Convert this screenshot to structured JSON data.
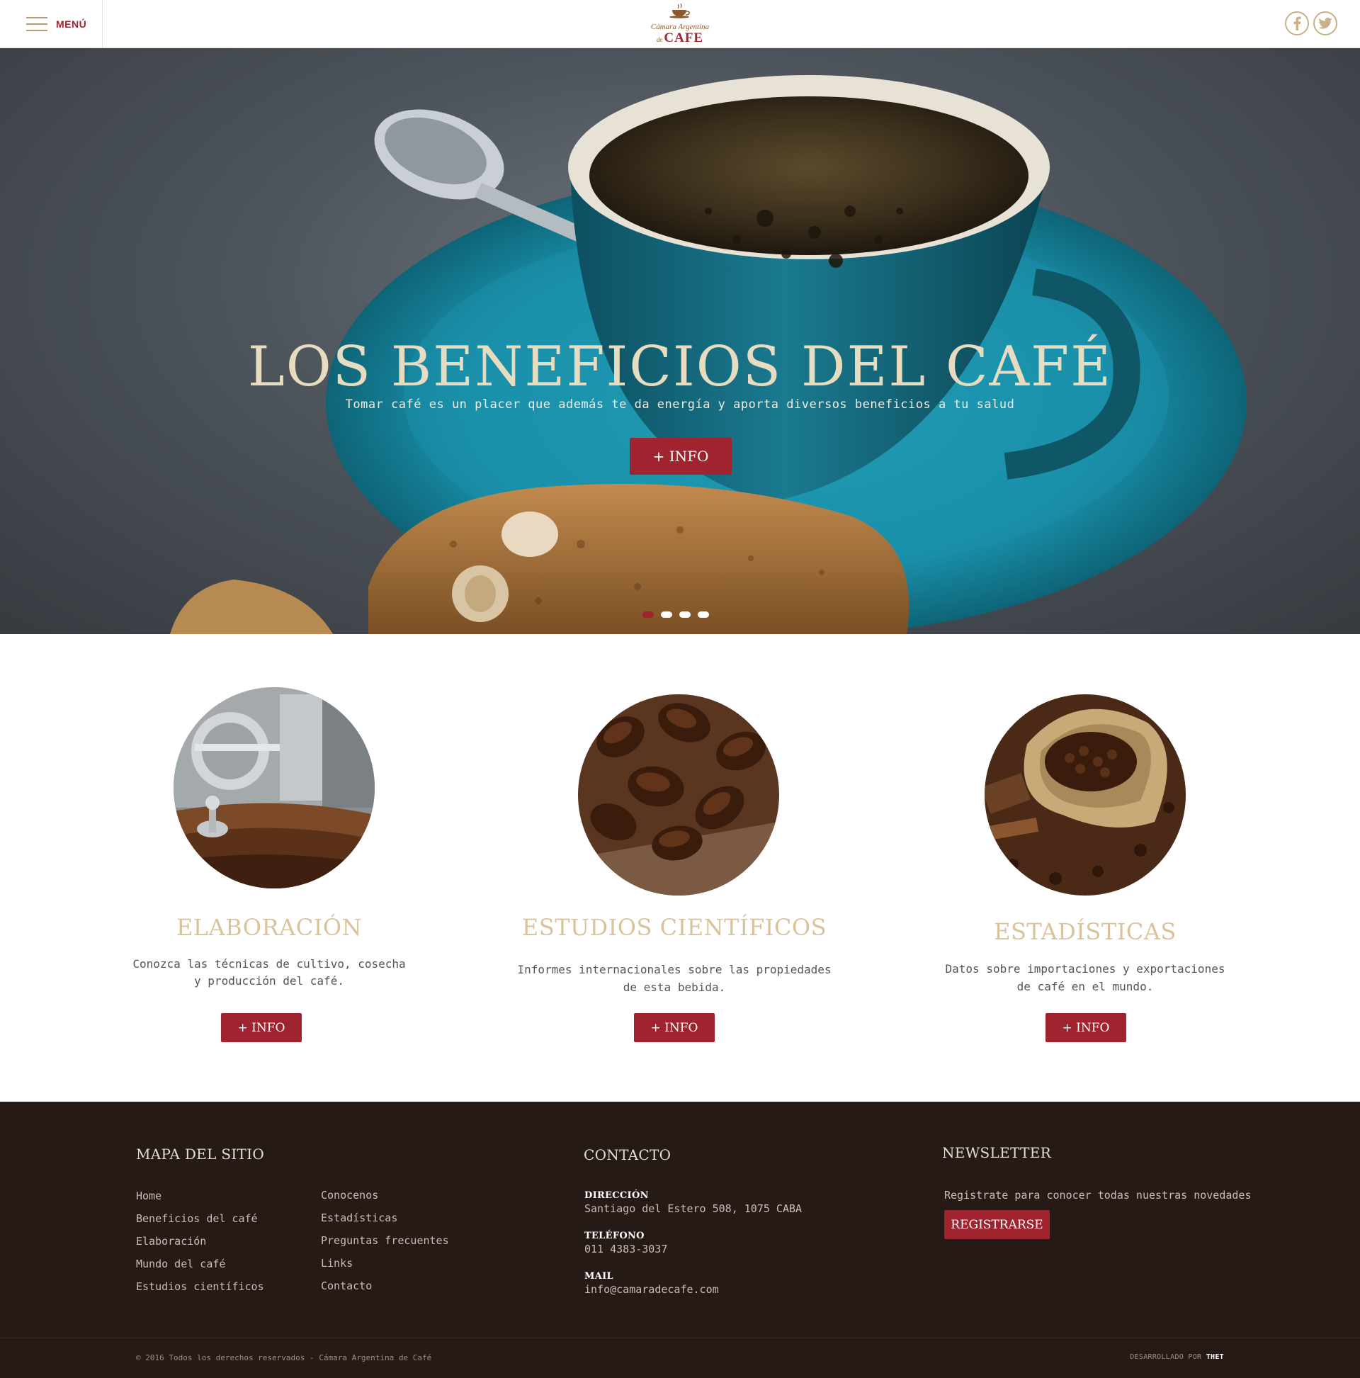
{
  "header": {
    "menu_label": "MENÚ",
    "logo_line1": "Cámara Argentina",
    "logo_de": "de",
    "logo_cafe": "CAFE"
  },
  "hero": {
    "title": "LOS BENEFICIOS DEL CAFÉ",
    "subtitle": "Tomar café es un placer que además te da energía y aporta diversos beneficios a tu salud",
    "button": "+ INFO",
    "slide_count": 4,
    "active_slide": 1
  },
  "features": [
    {
      "title": "ELABORACIÓN",
      "line1": "Conozca las técnicas de cultivo, cosecha",
      "line2": "y producción del café.",
      "button": "+ INFO"
    },
    {
      "title": "ESTUDIOS CIENTÍFICOS",
      "line1": "Informes internacionales sobre las propiedades",
      "line2": "de esta bebida.",
      "button": "+ INFO"
    },
    {
      "title": "ESTADÍSTICAS",
      "line1": "Datos sobre importaciones y exportaciones",
      "line2": "de café en el mundo.",
      "button": "+ INFO"
    }
  ],
  "footer": {
    "sitemap_title": "MAPA DEL SITIO",
    "sitemap_col1": [
      "Home",
      "Beneficios del café",
      "Elaboración",
      "Mundo del café",
      "Estudios científicos"
    ],
    "sitemap_col2": [
      "Conocenos",
      "Estadísticas",
      "Preguntas frecuentes",
      "Links",
      "Contacto"
    ],
    "contact_title": "CONTACTO",
    "address_label": "DIRECCIÓN",
    "address": "Santiago del Estero 508, 1075 CABA",
    "phone_label": "TELÉFONO",
    "phone": "011 4383-3037",
    "mail_label": "MAIL",
    "mail": "info@camaradecafe.com",
    "newsletter_title": "NEWSLETTER",
    "newsletter_text": "Registrate para conocer todas nuestras novedades",
    "newsletter_button": "REGISTRARSE",
    "copyright": "© 2016 Todos los derechos reservados - Cámara Argentina de Café",
    "dev_prefix": "DESARROLLADO POR",
    "dev_name": "THET"
  },
  "colors": {
    "accent": "#a0242f",
    "gold": "#d9c39b",
    "footer_bg": "#261a16"
  },
  "icons": [
    "hamburger-icon",
    "facebook-icon",
    "twitter-icon"
  ]
}
